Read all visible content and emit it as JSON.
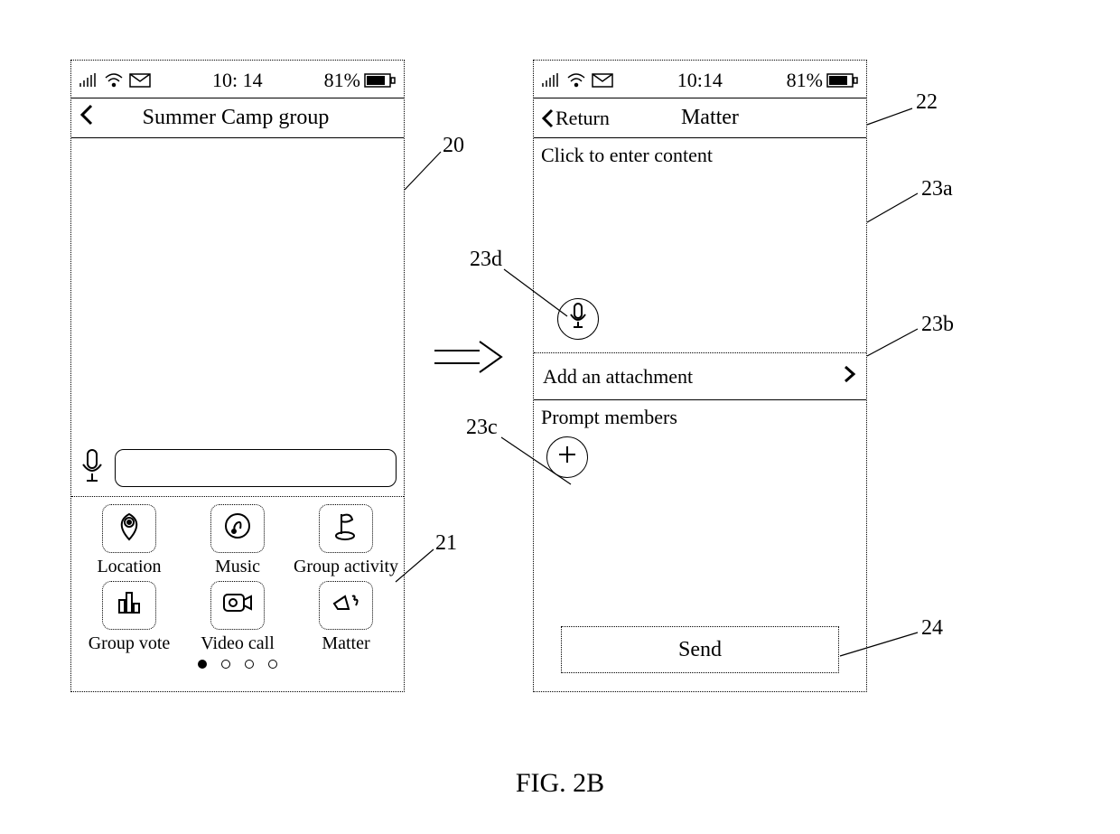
{
  "status": {
    "time": "10: 14",
    "time_r": "10:14",
    "battery": "81%"
  },
  "left": {
    "title": "Summer Camp group",
    "panel_items": [
      {
        "label": "Location",
        "icon": "pin-icon"
      },
      {
        "label": "Music",
        "icon": "music-icon"
      },
      {
        "label": "Group activity",
        "icon": "flag-icon"
      },
      {
        "label": "Group vote",
        "icon": "bars-icon"
      },
      {
        "label": "Video call",
        "icon": "camera-icon"
      },
      {
        "label": "Matter",
        "icon": "megaphone-icon"
      }
    ],
    "pager_count": 4
  },
  "right": {
    "return": "Return",
    "title": "Matter",
    "content_placeholder": "Click to enter content",
    "attach": "Add an attachment",
    "members": "Prompt members",
    "send": "Send"
  },
  "callouts": {
    "c20": "20",
    "c21": "21",
    "c22": "22",
    "c23a": "23a",
    "c23b": "23b",
    "c23c": "23c",
    "c23d": "23d",
    "c24": "24"
  },
  "figure": "FIG. 2B"
}
